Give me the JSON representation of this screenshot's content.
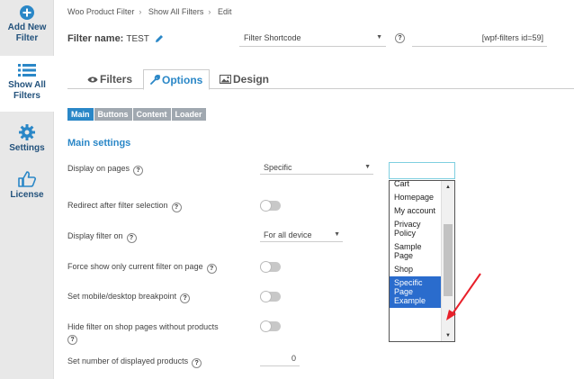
{
  "sidebar": {
    "items": [
      {
        "label_1": "Add New",
        "label_2": "Filter",
        "icon": "plus-circle-icon"
      },
      {
        "label_1": "Show All",
        "label_2": "Filters",
        "icon": "list-icon"
      },
      {
        "label_1": "Settings",
        "icon": "gear-icon"
      },
      {
        "label_1": "License",
        "icon": "thumbs-up-icon"
      }
    ]
  },
  "breadcrumb": [
    "Woo Product Filter",
    "Show All Filters",
    "Edit"
  ],
  "filter_name": {
    "label": "Filter name:",
    "value": "TEST"
  },
  "shortcode": {
    "select_value": "Filter Shortcode",
    "field_value": "[wpf-filters id=59]"
  },
  "tabs": [
    "Filters",
    "Options",
    "Design"
  ],
  "subtabs": [
    "Main",
    "Buttons",
    "Content",
    "Loader"
  ],
  "section_title": "Main settings",
  "help": "?",
  "rows": {
    "display_pages": {
      "label": "Display on pages",
      "value": "Specific"
    },
    "redirect": {
      "label": "Redirect after filter selection"
    },
    "display_on": {
      "label": "Display filter on",
      "value": "For all device"
    },
    "force_show": {
      "label": "Force show only current filter on page"
    },
    "breakpoint": {
      "label": "Set mobile/desktop breakpoint"
    },
    "hide_filter": {
      "label": "Hide filter on shop pages without products"
    },
    "num_products": {
      "label": "Set number of displayed products",
      "value": "0"
    }
  },
  "pages_list": {
    "items": [
      "Cart",
      "Homepage",
      "My account",
      "Privacy Policy",
      "Sample Page",
      "Shop",
      "Specific Page Example"
    ],
    "selected": "Specific Page Example"
  },
  "colors": {
    "accent": "#2a87c7",
    "selected": "#2a6ccd",
    "annotation": "#e8202a"
  }
}
